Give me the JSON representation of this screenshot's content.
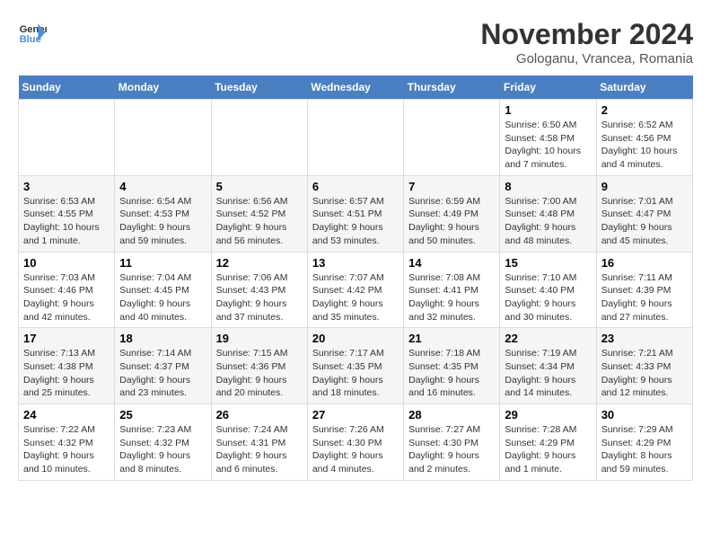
{
  "header": {
    "logo_line1": "General",
    "logo_line2": "Blue",
    "month": "November 2024",
    "location": "Gologanu, Vrancea, Romania"
  },
  "weekdays": [
    "Sunday",
    "Monday",
    "Tuesday",
    "Wednesday",
    "Thursday",
    "Friday",
    "Saturday"
  ],
  "weeks": [
    [
      {
        "day": "",
        "info": ""
      },
      {
        "day": "",
        "info": ""
      },
      {
        "day": "",
        "info": ""
      },
      {
        "day": "",
        "info": ""
      },
      {
        "day": "",
        "info": ""
      },
      {
        "day": "1",
        "info": "Sunrise: 6:50 AM\nSunset: 4:58 PM\nDaylight: 10 hours and 7 minutes."
      },
      {
        "day": "2",
        "info": "Sunrise: 6:52 AM\nSunset: 4:56 PM\nDaylight: 10 hours and 4 minutes."
      }
    ],
    [
      {
        "day": "3",
        "info": "Sunrise: 6:53 AM\nSunset: 4:55 PM\nDaylight: 10 hours and 1 minute."
      },
      {
        "day": "4",
        "info": "Sunrise: 6:54 AM\nSunset: 4:53 PM\nDaylight: 9 hours and 59 minutes."
      },
      {
        "day": "5",
        "info": "Sunrise: 6:56 AM\nSunset: 4:52 PM\nDaylight: 9 hours and 56 minutes."
      },
      {
        "day": "6",
        "info": "Sunrise: 6:57 AM\nSunset: 4:51 PM\nDaylight: 9 hours and 53 minutes."
      },
      {
        "day": "7",
        "info": "Sunrise: 6:59 AM\nSunset: 4:49 PM\nDaylight: 9 hours and 50 minutes."
      },
      {
        "day": "8",
        "info": "Sunrise: 7:00 AM\nSunset: 4:48 PM\nDaylight: 9 hours and 48 minutes."
      },
      {
        "day": "9",
        "info": "Sunrise: 7:01 AM\nSunset: 4:47 PM\nDaylight: 9 hours and 45 minutes."
      }
    ],
    [
      {
        "day": "10",
        "info": "Sunrise: 7:03 AM\nSunset: 4:46 PM\nDaylight: 9 hours and 42 minutes."
      },
      {
        "day": "11",
        "info": "Sunrise: 7:04 AM\nSunset: 4:45 PM\nDaylight: 9 hours and 40 minutes."
      },
      {
        "day": "12",
        "info": "Sunrise: 7:06 AM\nSunset: 4:43 PM\nDaylight: 9 hours and 37 minutes."
      },
      {
        "day": "13",
        "info": "Sunrise: 7:07 AM\nSunset: 4:42 PM\nDaylight: 9 hours and 35 minutes."
      },
      {
        "day": "14",
        "info": "Sunrise: 7:08 AM\nSunset: 4:41 PM\nDaylight: 9 hours and 32 minutes."
      },
      {
        "day": "15",
        "info": "Sunrise: 7:10 AM\nSunset: 4:40 PM\nDaylight: 9 hours and 30 minutes."
      },
      {
        "day": "16",
        "info": "Sunrise: 7:11 AM\nSunset: 4:39 PM\nDaylight: 9 hours and 27 minutes."
      }
    ],
    [
      {
        "day": "17",
        "info": "Sunrise: 7:13 AM\nSunset: 4:38 PM\nDaylight: 9 hours and 25 minutes."
      },
      {
        "day": "18",
        "info": "Sunrise: 7:14 AM\nSunset: 4:37 PM\nDaylight: 9 hours and 23 minutes."
      },
      {
        "day": "19",
        "info": "Sunrise: 7:15 AM\nSunset: 4:36 PM\nDaylight: 9 hours and 20 minutes."
      },
      {
        "day": "20",
        "info": "Sunrise: 7:17 AM\nSunset: 4:35 PM\nDaylight: 9 hours and 18 minutes."
      },
      {
        "day": "21",
        "info": "Sunrise: 7:18 AM\nSunset: 4:35 PM\nDaylight: 9 hours and 16 minutes."
      },
      {
        "day": "22",
        "info": "Sunrise: 7:19 AM\nSunset: 4:34 PM\nDaylight: 9 hours and 14 minutes."
      },
      {
        "day": "23",
        "info": "Sunrise: 7:21 AM\nSunset: 4:33 PM\nDaylight: 9 hours and 12 minutes."
      }
    ],
    [
      {
        "day": "24",
        "info": "Sunrise: 7:22 AM\nSunset: 4:32 PM\nDaylight: 9 hours and 10 minutes."
      },
      {
        "day": "25",
        "info": "Sunrise: 7:23 AM\nSunset: 4:32 PM\nDaylight: 9 hours and 8 minutes."
      },
      {
        "day": "26",
        "info": "Sunrise: 7:24 AM\nSunset: 4:31 PM\nDaylight: 9 hours and 6 minutes."
      },
      {
        "day": "27",
        "info": "Sunrise: 7:26 AM\nSunset: 4:30 PM\nDaylight: 9 hours and 4 minutes."
      },
      {
        "day": "28",
        "info": "Sunrise: 7:27 AM\nSunset: 4:30 PM\nDaylight: 9 hours and 2 minutes."
      },
      {
        "day": "29",
        "info": "Sunrise: 7:28 AM\nSunset: 4:29 PM\nDaylight: 9 hours and 1 minute."
      },
      {
        "day": "30",
        "info": "Sunrise: 7:29 AM\nSunset: 4:29 PM\nDaylight: 8 hours and 59 minutes."
      }
    ]
  ]
}
